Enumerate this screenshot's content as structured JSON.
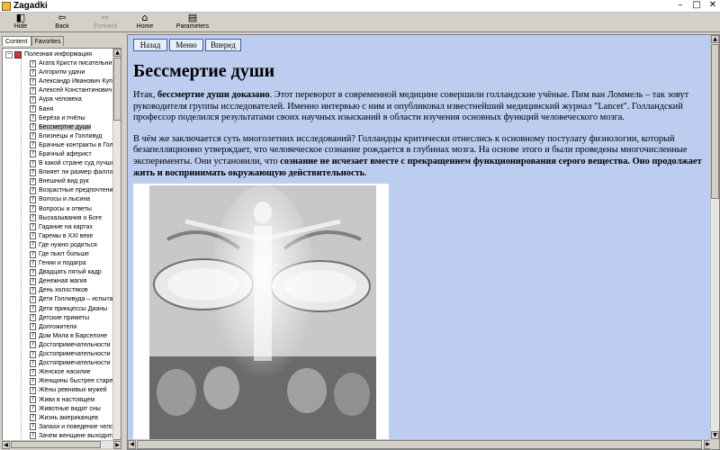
{
  "window": {
    "title": "Zagadki",
    "minimize": "–",
    "maximize": "□",
    "close": "✕"
  },
  "toolbar": {
    "hide": "Hide",
    "back": "Back",
    "forward": "Forward",
    "home": "Home",
    "parameters": "Parameters"
  },
  "tabs": {
    "contents": "Content",
    "favorites": "Favorites"
  },
  "tree": {
    "root_label": "Полезная информация",
    "items": [
      "Агата Кристи писательниц",
      "Алгоритм удачи",
      "Александр Иванович Купр",
      "Алексей Константинович",
      "Аура человека",
      "Баня",
      "Берёза и пчёлы",
      "Бессмертие души",
      "Близнецы и Голливуд",
      "Брачные контракты в Голл",
      "Брачный аферист",
      "В какой стране суд лучше",
      "Влияет ли размер фалло",
      "Внешний вид рук",
      "Возрастные предпочтени",
      "Волосы и лысина",
      "Вопросы и ответы",
      "Высказывания о Боге",
      "Гадание на картах",
      "Гаремы в XXI веке",
      "Где нужно родиться",
      "Где пьют больше",
      "Гении и подагра",
      "Двадцать пятый кадр",
      "Денежная магия",
      "День холостяков",
      "Дети Голливуда – испытан",
      "Дети принцессы Дианы",
      "Детские приметы",
      "Долгожители",
      "Дом Мила в Барселоне",
      "Достопримечательности I",
      "Достопримечательности I",
      "Достопримечательности I",
      "Женское насилие",
      "Женщины быстрее старею",
      "Жёны ревнивых мужей",
      "Живи в настоящем",
      "Животные видят сны",
      "Жизнь американцев",
      "Запахи и поведение чело",
      "Зачем женщине выходить"
    ],
    "selected_index": 7
  },
  "nav": {
    "back": "Назад",
    "menu": "Меню",
    "forward": "Вперед"
  },
  "article": {
    "title": "Бессмертие души",
    "p1_start": "Итак, ",
    "p1_bold": "бессмертие души доказано",
    "p1_rest": ". Этот переворот в современной медицине совершили голландские учёные. Пим ван Ломмель – так зовут руководителя группы исследователей. Именно интервью с ним и опубликовал известнейший медицинский журнал \"Lancet\". Голландский профессор поделился результатами своих научных изысканий в области изучения основных функций человеческого мозга.",
    "p2_start": "В чём же заключается суть многолетних исследований? Голландцы критически отнеслись к основному постулату физиологии, который безапелляционно утверждает, что человеческое сознание рождается в глубинах мозга. На основе этого и были проведены многочисленные эксперименты. Они установили, что ",
    "p2_bold": "сознание не исчезает вместе с прекращением функционирования серого вещества. Оно продолжает жить и воспринимать окружающую действительность",
    "p2_end": "."
  },
  "colors": {
    "content_bg": "#bccdf0",
    "selected_item_bg": "#cccccc"
  }
}
